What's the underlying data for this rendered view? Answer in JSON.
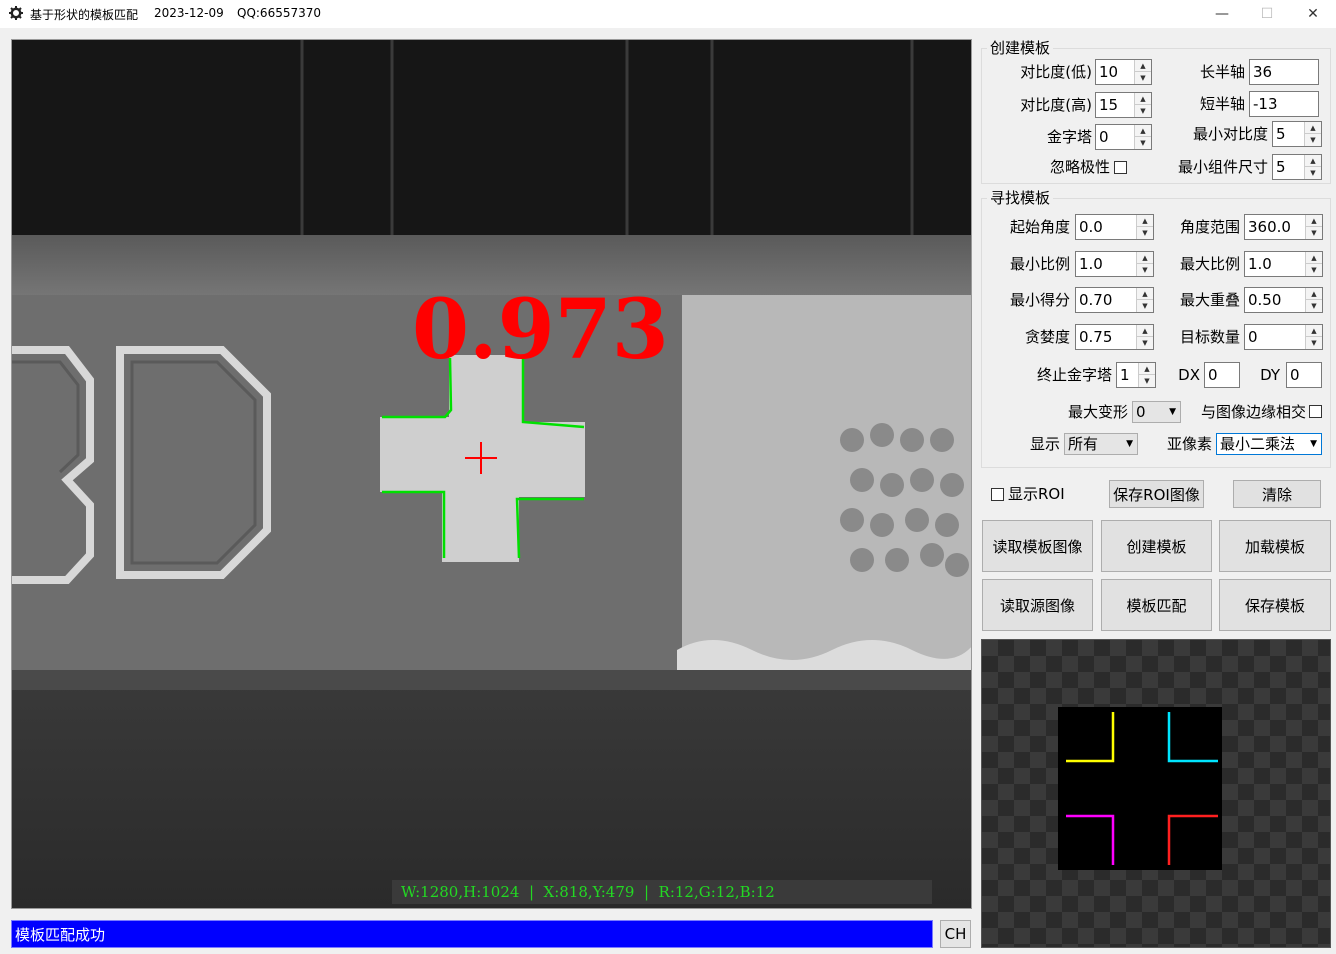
{
  "window": {
    "title": "基于形状的模板匹配",
    "date": "2023-12-09",
    "qq": "QQ:66557370",
    "minimize": "—",
    "maximize": "☐",
    "close": "✕"
  },
  "viewer": {
    "score_text": "0.973",
    "info": "W:1280,H:1024  |  X:818,Y:479  |  R:12,G:12,B:12",
    "overlay_colors": {
      "score": "#ff0000",
      "contour": "#00e000",
      "center": "#ff0000"
    }
  },
  "status": {
    "message": "模板匹配成功",
    "ch": "CH"
  },
  "create_group": {
    "title": "创建模板",
    "contrast_low_label": "对比度(低)",
    "contrast_low": "10",
    "contrast_high_label": "对比度(高)",
    "contrast_high": "15",
    "pyramid_label": "金字塔",
    "pyramid": "0",
    "ignore_polarity_label": "忽略极性",
    "major_axis_label": "长半轴",
    "major_axis": "36",
    "minor_axis_label": "短半轴",
    "minor_axis": "-13",
    "min_contrast_label": "最小对比度",
    "min_contrast": "5",
    "min_component_label": "最小组件尺寸",
    "min_component": "5"
  },
  "find_group": {
    "title": "寻找模板",
    "start_angle_label": "起始角度",
    "start_angle": "0.0",
    "angle_range_label": "角度范围",
    "angle_range": "360.0",
    "min_scale_label": "最小比例",
    "min_scale": "1.0",
    "max_scale_label": "最大比例",
    "max_scale": "1.0",
    "min_score_label": "最小得分",
    "min_score": "0.70",
    "max_overlap_label": "最大重叠",
    "max_overlap": "0.50",
    "greediness_label": "贪婪度",
    "greediness": "0.75",
    "num_matches_label": "目标数量",
    "num_matches": "0",
    "end_pyramid_label": "终止金字塔",
    "end_pyramid": "1",
    "dx_label": "DX",
    "dx": "0",
    "dy_label": "DY",
    "dy": "0",
    "max_deform_label": "最大变形",
    "max_deform": "0",
    "border_label": "与图像边缘相交",
    "display_label": "显示",
    "display": "所有",
    "subpixel_label": "亚像素",
    "subpixel": "最小二乘法"
  },
  "roi": {
    "show_roi_label": "显示ROI",
    "save_roi": "保存ROI图像",
    "clear": "清除"
  },
  "buttons": {
    "read_template_image": "读取模板图像",
    "create_template": "创建模板",
    "load_template": "加载模板",
    "read_source_image": "读取源图像",
    "template_match": "模板匹配",
    "save_template": "保存模板"
  },
  "preview": {
    "corner_colors": [
      "#ffff00",
      "#00e5ff",
      "#ff00ff",
      "#ff2020"
    ]
  }
}
